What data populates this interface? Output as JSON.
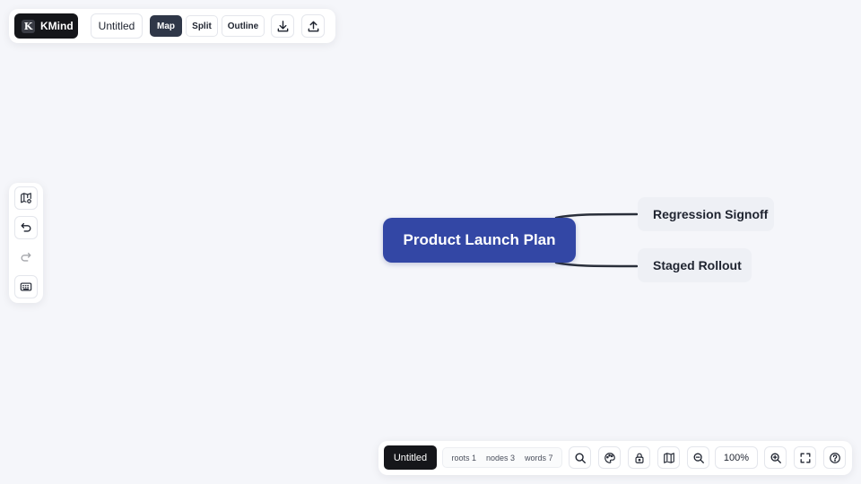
{
  "toolbar": {
    "brand_initial": "K",
    "brand_name": "KMind",
    "document_title": "Untitled",
    "views": [
      {
        "label": "Map",
        "active": true
      },
      {
        "label": "Split",
        "active": false
      },
      {
        "label": "Outline",
        "active": false
      }
    ],
    "icons": [
      "download-icon",
      "upload-icon"
    ]
  },
  "sidebar": {
    "icons": [
      "map-settings-icon",
      "undo-icon",
      "redo-icon",
      "keyboard-icon"
    ],
    "redo_disabled": true
  },
  "mindmap": {
    "root": "Product Launch Plan",
    "children": [
      "Regression Signoff",
      "Staged Rollout"
    ],
    "colors": {
      "root_bg": "#3347a5",
      "child_bg": "#eef0f5",
      "edge": "#2a2f3a"
    }
  },
  "bottombar": {
    "document_title": "Untitled",
    "stats": {
      "roots": "roots 1",
      "nodes": "nodes 3",
      "words": "words 7"
    },
    "zoom": "100%",
    "icons": [
      "search-icon",
      "theme-icon",
      "lock-icon",
      "minimap-icon",
      "zoom-out-icon",
      "zoom-in-icon",
      "fullscreen-icon",
      "help-icon"
    ]
  }
}
